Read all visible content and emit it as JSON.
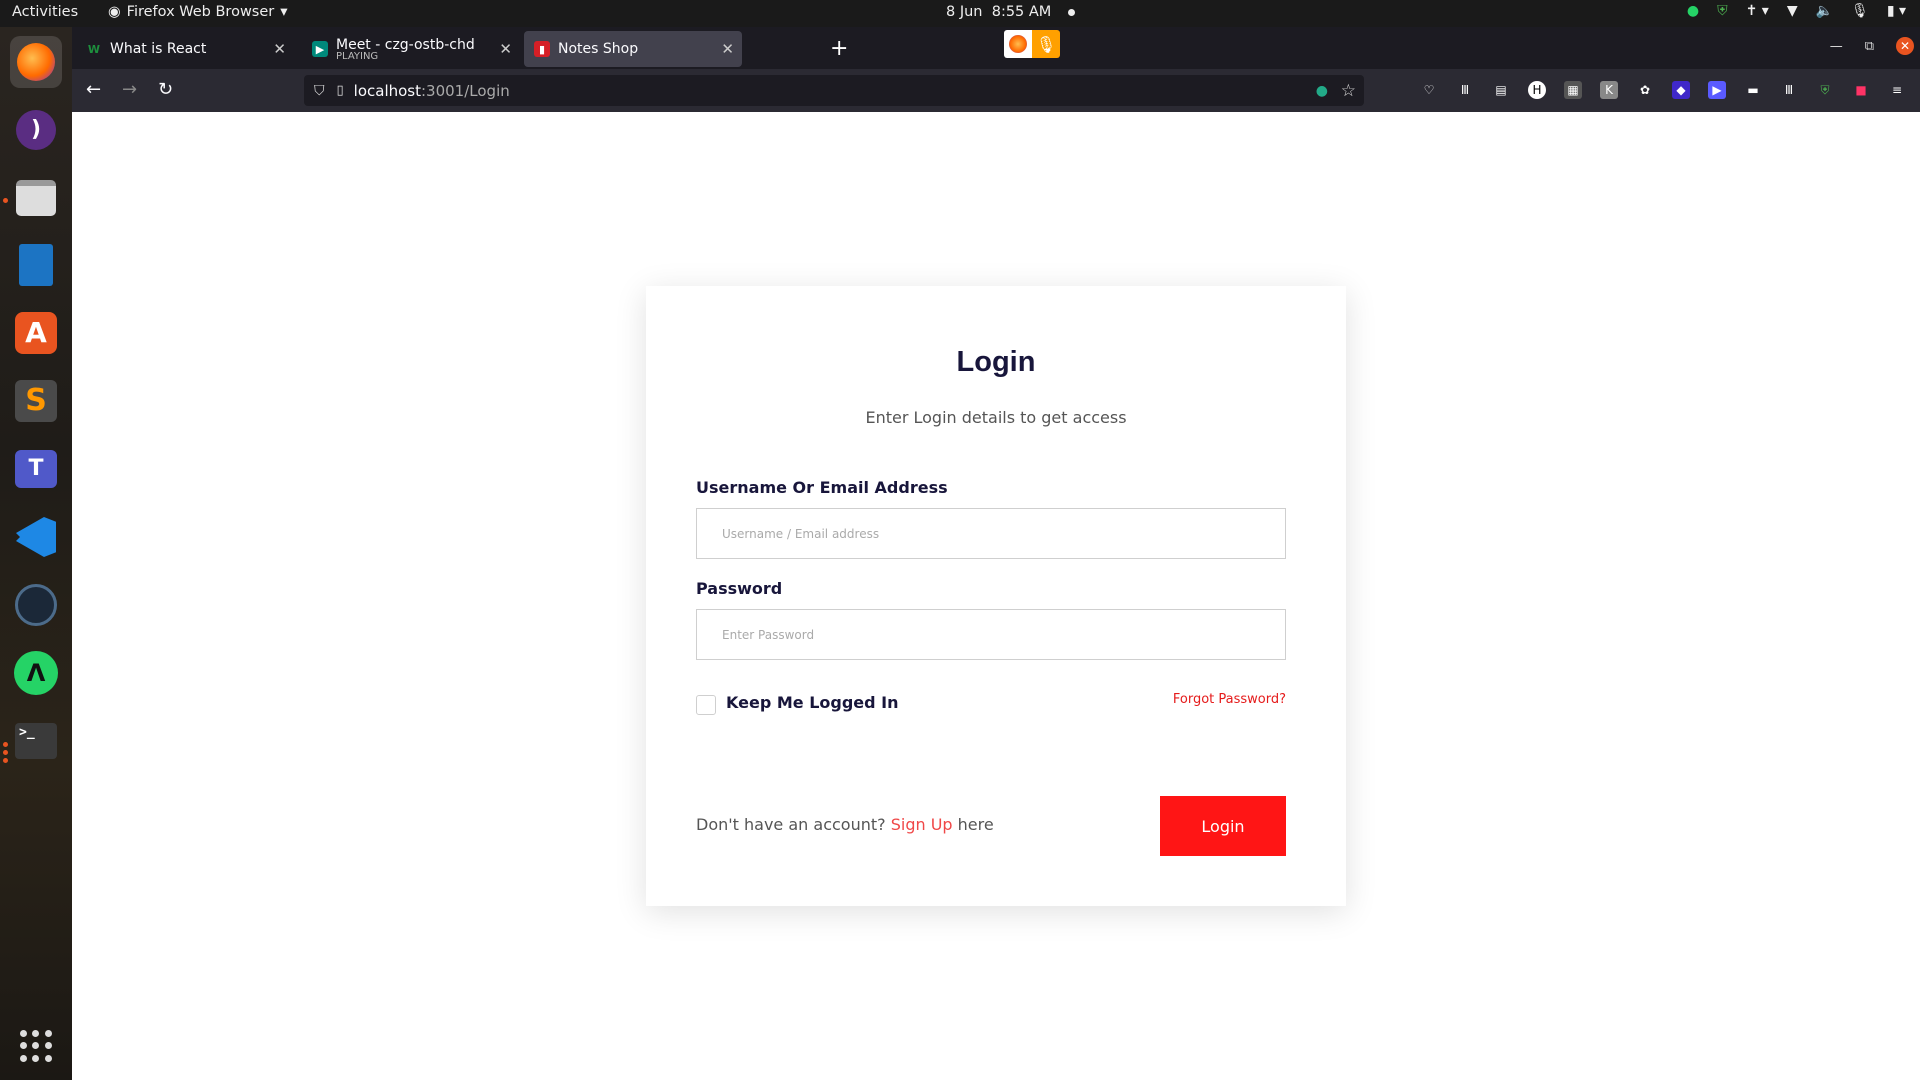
{
  "topbar": {
    "activities": "Activities",
    "app_name": "Firefox Web Browser",
    "date": "8 Jun",
    "time": "8:55 AM"
  },
  "browser": {
    "tabs": [
      {
        "title": "What is React",
        "sub": "",
        "icon_color": "#1d8f3d"
      },
      {
        "title": "Meet - czg-ostb-chd",
        "sub": "PLAYING",
        "icon_color": "#00897b"
      },
      {
        "title": "Notes Shop",
        "sub": "",
        "icon_color": "#d61f26"
      }
    ],
    "url_host": "localhost",
    "url_path": ":3001/Login"
  },
  "login": {
    "title": "Login",
    "subtitle": "Enter Login details to get access",
    "username_label": "Username Or Email Address",
    "username_placeholder": "Username / Email address",
    "password_label": "Password",
    "password_placeholder": "Enter Password",
    "keep_logged_in": "Keep Me Logged In",
    "forgot_password": "Forgot Password?",
    "no_account_text": "Don't have an account?",
    "sign_up_link": "Sign Up",
    "here_text": " here",
    "login_button": "Login"
  },
  "colors": {
    "accent": "#ff1515",
    "heading": "#18163b"
  },
  "dock_icons": [
    "firefox-icon",
    "podcast-icon",
    "files-icon",
    "writer-icon",
    "app-store-icon",
    "sublime-text-icon",
    "teams-icon",
    "vscode-icon",
    "steam-icon",
    "whatsapp-icon",
    "terminal-icon"
  ]
}
